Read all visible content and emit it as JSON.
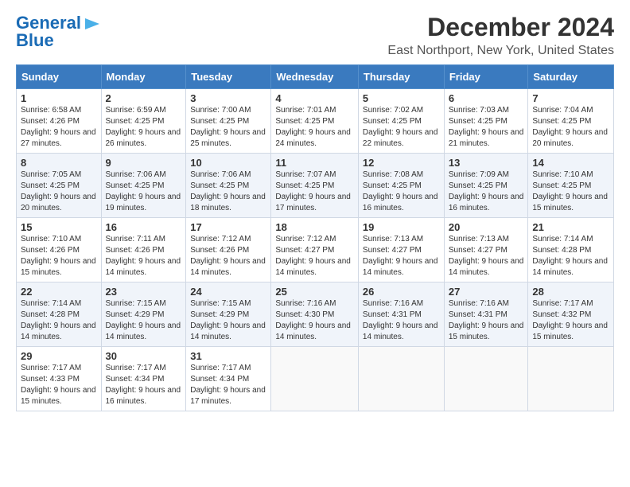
{
  "header": {
    "logo_line1": "General",
    "logo_line2": "Blue",
    "title": "December 2024",
    "subtitle": "East Northport, New York, United States"
  },
  "days_of_week": [
    "Sunday",
    "Monday",
    "Tuesday",
    "Wednesday",
    "Thursday",
    "Friday",
    "Saturday"
  ],
  "weeks": [
    [
      {
        "day": "1",
        "sunrise": "6:58 AM",
        "sunset": "4:26 PM",
        "daylight": "9 hours and 27 minutes."
      },
      {
        "day": "2",
        "sunrise": "6:59 AM",
        "sunset": "4:25 PM",
        "daylight": "9 hours and 26 minutes."
      },
      {
        "day": "3",
        "sunrise": "7:00 AM",
        "sunset": "4:25 PM",
        "daylight": "9 hours and 25 minutes."
      },
      {
        "day": "4",
        "sunrise": "7:01 AM",
        "sunset": "4:25 PM",
        "daylight": "9 hours and 24 minutes."
      },
      {
        "day": "5",
        "sunrise": "7:02 AM",
        "sunset": "4:25 PM",
        "daylight": "9 hours and 22 minutes."
      },
      {
        "day": "6",
        "sunrise": "7:03 AM",
        "sunset": "4:25 PM",
        "daylight": "9 hours and 21 minutes."
      },
      {
        "day": "7",
        "sunrise": "7:04 AM",
        "sunset": "4:25 PM",
        "daylight": "9 hours and 20 minutes."
      }
    ],
    [
      {
        "day": "8",
        "sunrise": "7:05 AM",
        "sunset": "4:25 PM",
        "daylight": "9 hours and 20 minutes."
      },
      {
        "day": "9",
        "sunrise": "7:06 AM",
        "sunset": "4:25 PM",
        "daylight": "9 hours and 19 minutes."
      },
      {
        "day": "10",
        "sunrise": "7:06 AM",
        "sunset": "4:25 PM",
        "daylight": "9 hours and 18 minutes."
      },
      {
        "day": "11",
        "sunrise": "7:07 AM",
        "sunset": "4:25 PM",
        "daylight": "9 hours and 17 minutes."
      },
      {
        "day": "12",
        "sunrise": "7:08 AM",
        "sunset": "4:25 PM",
        "daylight": "9 hours and 16 minutes."
      },
      {
        "day": "13",
        "sunrise": "7:09 AM",
        "sunset": "4:25 PM",
        "daylight": "9 hours and 16 minutes."
      },
      {
        "day": "14",
        "sunrise": "7:10 AM",
        "sunset": "4:25 PM",
        "daylight": "9 hours and 15 minutes."
      }
    ],
    [
      {
        "day": "15",
        "sunrise": "7:10 AM",
        "sunset": "4:26 PM",
        "daylight": "9 hours and 15 minutes."
      },
      {
        "day": "16",
        "sunrise": "7:11 AM",
        "sunset": "4:26 PM",
        "daylight": "9 hours and 14 minutes."
      },
      {
        "day": "17",
        "sunrise": "7:12 AM",
        "sunset": "4:26 PM",
        "daylight": "9 hours and 14 minutes."
      },
      {
        "day": "18",
        "sunrise": "7:12 AM",
        "sunset": "4:27 PM",
        "daylight": "9 hours and 14 minutes."
      },
      {
        "day": "19",
        "sunrise": "7:13 AM",
        "sunset": "4:27 PM",
        "daylight": "9 hours and 14 minutes."
      },
      {
        "day": "20",
        "sunrise": "7:13 AM",
        "sunset": "4:27 PM",
        "daylight": "9 hours and 14 minutes."
      },
      {
        "day": "21",
        "sunrise": "7:14 AM",
        "sunset": "4:28 PM",
        "daylight": "9 hours and 14 minutes."
      }
    ],
    [
      {
        "day": "22",
        "sunrise": "7:14 AM",
        "sunset": "4:28 PM",
        "daylight": "9 hours and 14 minutes."
      },
      {
        "day": "23",
        "sunrise": "7:15 AM",
        "sunset": "4:29 PM",
        "daylight": "9 hours and 14 minutes."
      },
      {
        "day": "24",
        "sunrise": "7:15 AM",
        "sunset": "4:29 PM",
        "daylight": "9 hours and 14 minutes."
      },
      {
        "day": "25",
        "sunrise": "7:16 AM",
        "sunset": "4:30 PM",
        "daylight": "9 hours and 14 minutes."
      },
      {
        "day": "26",
        "sunrise": "7:16 AM",
        "sunset": "4:31 PM",
        "daylight": "9 hours and 14 minutes."
      },
      {
        "day": "27",
        "sunrise": "7:16 AM",
        "sunset": "4:31 PM",
        "daylight": "9 hours and 15 minutes."
      },
      {
        "day": "28",
        "sunrise": "7:17 AM",
        "sunset": "4:32 PM",
        "daylight": "9 hours and 15 minutes."
      }
    ],
    [
      {
        "day": "29",
        "sunrise": "7:17 AM",
        "sunset": "4:33 PM",
        "daylight": "9 hours and 15 minutes."
      },
      {
        "day": "30",
        "sunrise": "7:17 AM",
        "sunset": "4:34 PM",
        "daylight": "9 hours and 16 minutes."
      },
      {
        "day": "31",
        "sunrise": "7:17 AM",
        "sunset": "4:34 PM",
        "daylight": "9 hours and 17 minutes."
      },
      null,
      null,
      null,
      null
    ]
  ],
  "labels": {
    "sunrise": "Sunrise:",
    "sunset": "Sunset:",
    "daylight": "Daylight:"
  }
}
